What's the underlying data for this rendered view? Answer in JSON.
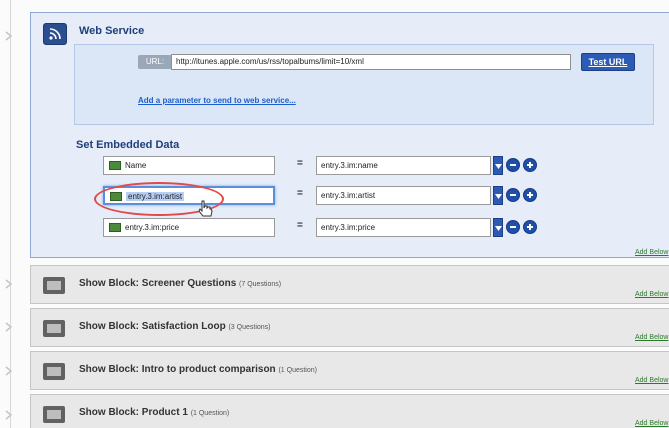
{
  "web_service": {
    "title": "Web Service",
    "url_label": "URL:",
    "url_value": "http://itunes.apple.com/us/rss/topalbums/limit=10/xml",
    "test_url_label": "Test URL",
    "add_param_link": "Add a parameter to send to web service..."
  },
  "embedded": {
    "title": "Set Embedded Data",
    "equals": "=",
    "rows": [
      {
        "field": "Name",
        "source": "entry.3.im:name"
      },
      {
        "field": "entry.3.im:artist",
        "source": "entry.3.im:artist"
      },
      {
        "field": "entry.3.im:price",
        "source": "entry.3.im:price"
      }
    ]
  },
  "add_below_label": "Add Below",
  "blocks": [
    {
      "title": "Show Block: Screener Questions",
      "count": "(7 Questions)"
    },
    {
      "title": "Show Block: Satisfaction Loop",
      "count": "(3 Questions)"
    },
    {
      "title": "Show Block: Intro to product comparison",
      "count": "(1 Question)"
    },
    {
      "title": "Show Block: Product 1",
      "count": "(1 Question)"
    }
  ],
  "icons": {
    "web_service": "rss-feed-icon",
    "field": "embedded-field-icon",
    "block": "block-icon",
    "timeline": "arrow-right-icon",
    "dropdown": "chevron-down-icon",
    "remove": "minus-circle-icon",
    "add": "plus-circle-icon",
    "cursor": "hand-cursor-icon"
  },
  "colors": {
    "accent": "#2b5bb5",
    "web_service_bg": "#e6edf8",
    "web_service_border": "#90a9d6",
    "block_bg": "#e8e8e8",
    "highlight_circle": "#e04a4a",
    "link": "#1d5fcf",
    "add_below": "#2d7a2d"
  }
}
